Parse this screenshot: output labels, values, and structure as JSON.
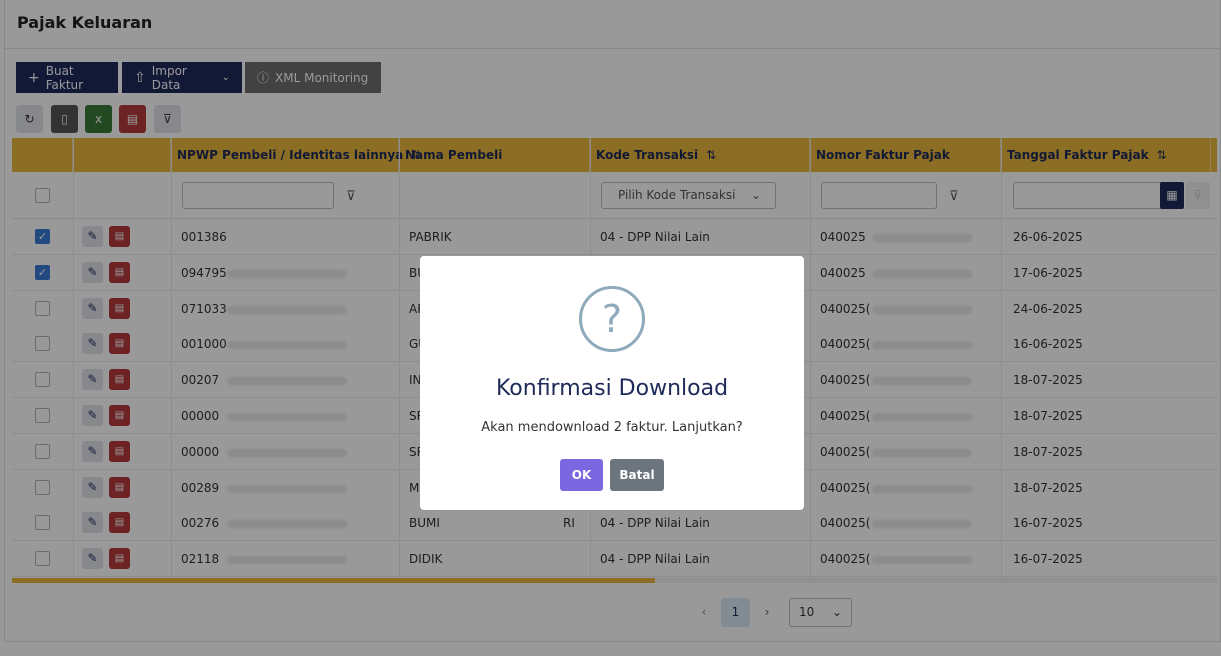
{
  "page": {
    "title": "Pajak Keluaran"
  },
  "toolbar": {
    "buat_faktur": "Buat Faktur",
    "impor_data": "Impor Data",
    "xml_monitoring": "XML Monitoring"
  },
  "icons": {
    "refresh": "refresh-icon",
    "document": "document-icon",
    "excel": "excel-icon",
    "pdf": "pdf-icon",
    "clear_filter": "clear-filter-icon"
  },
  "table": {
    "columns": [
      "NPWP Pembeli / Identitas lainnya",
      "Nama Pembeli",
      "Kode Transaksi",
      "Nomor Faktur Pajak",
      "Tanggal Faktur Pajak"
    ],
    "sort_glyph": "⇅",
    "kode_placeholder": "Pilih Kode Transaksi",
    "rows": [
      {
        "checked": true,
        "npwp": "001386",
        "nama": "PABRIK",
        "nama_suffix": "",
        "kode": "04 - DPP Nilai Lain",
        "nomor": "040025",
        "tanggal": "26-06-2025"
      },
      {
        "checked": true,
        "npwp": "094795",
        "nama": "BU",
        "nama_suffix": "",
        "kode": "",
        "nomor": "040025",
        "tanggal": "17-06-2025"
      },
      {
        "checked": false,
        "npwp": "071033",
        "nama": "AF",
        "nama_suffix": "",
        "kode": "",
        "nomor": "040025(",
        "tanggal": "24-06-2025"
      },
      {
        "checked": false,
        "npwp": "001000",
        "nama": "GU",
        "nama_suffix": "",
        "kode": "",
        "nomor": "040025(",
        "tanggal": "16-06-2025"
      },
      {
        "checked": false,
        "npwp": "00207",
        "nama": "IN",
        "nama_suffix": "",
        "kode": "",
        "nomor": "040025(",
        "tanggal": "18-07-2025"
      },
      {
        "checked": false,
        "npwp": "00000",
        "nama": "SR",
        "nama_suffix": "",
        "kode": "",
        "nomor": "040025(",
        "tanggal": "18-07-2025"
      },
      {
        "checked": false,
        "npwp": "00000",
        "nama": "SR",
        "nama_suffix": "",
        "kode": "",
        "nomor": "040025(",
        "tanggal": "18-07-2025"
      },
      {
        "checked": false,
        "npwp": "00289",
        "nama": "M",
        "nama_suffix": "",
        "kode": "",
        "nomor": "040025(",
        "tanggal": "18-07-2025"
      },
      {
        "checked": false,
        "npwp": "00276",
        "nama": "BUMI",
        "nama_suffix": "RI",
        "kode": "04 - DPP Nilai Lain",
        "nomor": "040025(",
        "tanggal": "16-07-2025"
      },
      {
        "checked": false,
        "npwp": "02118",
        "nama": "DIDIK",
        "nama_suffix": "",
        "kode": "04 - DPP Nilai Lain",
        "nomor": "040025(",
        "tanggal": "16-07-2025"
      }
    ]
  },
  "pagination": {
    "prev": "‹",
    "page": "1",
    "next": "›",
    "page_size": "10"
  },
  "modal": {
    "icon": "?",
    "title": "Konfirmasi Download",
    "message": "Akan mendownload 2 faktur. Lanjutkan?",
    "ok": "OK",
    "cancel": "Batal"
  },
  "colors": {
    "header": "#e8b83b",
    "navy": "#1e2a5a",
    "ok": "#7b68e0",
    "cancel": "#6c757d"
  }
}
